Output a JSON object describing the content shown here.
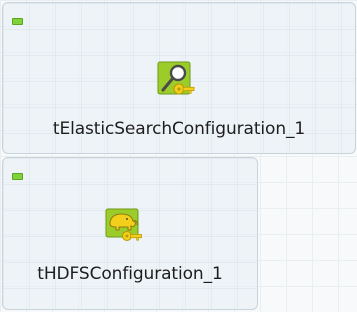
{
  "components": [
    {
      "name": "tElasticSearchConfiguration_1",
      "icon": "elasticsearch-config-icon"
    },
    {
      "name": "tHDFSConfiguration_1",
      "icon": "hdfs-config-icon"
    }
  ],
  "colors": {
    "toggle": "#7fd23a",
    "icon_green": "#9ccc2a",
    "key_yellow": "#f2cf1a"
  }
}
